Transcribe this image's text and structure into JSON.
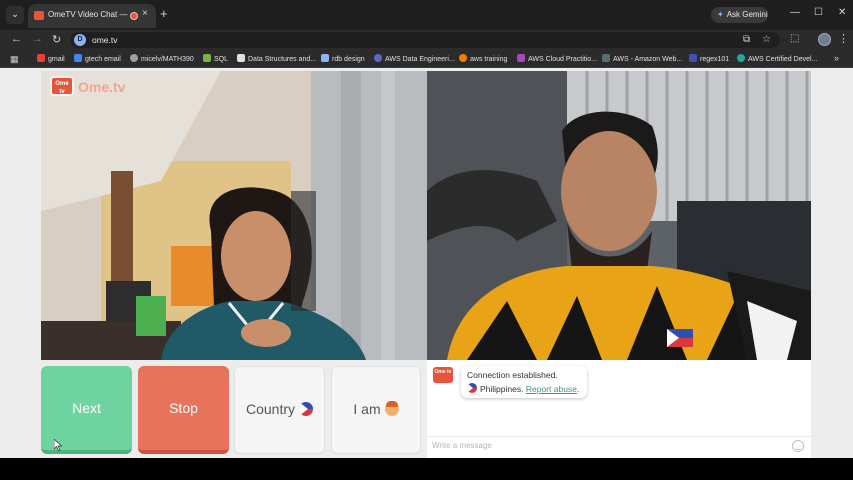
{
  "browser": {
    "tab_title": "OmeTV Video Chat — Ome",
    "tab_close": "×",
    "new_tab": "+",
    "ask_gemini": "Ask Gemini",
    "url": "ome.tv",
    "window_controls": {
      "minimize": "—",
      "maximize": "☐",
      "close": "✕"
    },
    "bookmarks": [
      {
        "label": "gmail",
        "color": "#ea4335"
      },
      {
        "label": "gtech email",
        "color": "#4285f4"
      },
      {
        "label": "micelv/MATH390",
        "color": "#9aa0a6"
      },
      {
        "label": "SQL",
        "color": "#7cb342"
      },
      {
        "label": "Data Structures and...",
        "color": "#e0e0e0"
      },
      {
        "label": "rdb design",
        "color": "#8ab4f8"
      },
      {
        "label": "AWS Data Engineeri...",
        "color": "#5c6bc0"
      },
      {
        "label": "aws training",
        "color": "#f57c00"
      },
      {
        "label": "AWS Cloud Practitio...",
        "color": "#ab47bc"
      },
      {
        "label": "AWS - Amazon Web...",
        "color": "#263238"
      },
      {
        "label": "regex101",
        "color": "#3f51b5"
      },
      {
        "label": "AWS Certified Devel...",
        "color": "#26a69a"
      }
    ]
  },
  "page": {
    "logo_badge": "Ome tv",
    "logo_text": "Ome.tv",
    "buttons": {
      "next": "Next",
      "stop": "Stop",
      "country": "Country",
      "iam": "I am"
    },
    "chat": {
      "logo_badge": "Ome tv",
      "connection_msg": "Connection established.",
      "country": "Philippines.",
      "report_abuse": "Report abuse",
      "report_suffix": ".",
      "input_placeholder": "Write a message"
    },
    "colors": {
      "next": "#6fd39f",
      "stop": "#e8735c",
      "accent": "#e8533b",
      "link": "#3a9b6e"
    }
  }
}
